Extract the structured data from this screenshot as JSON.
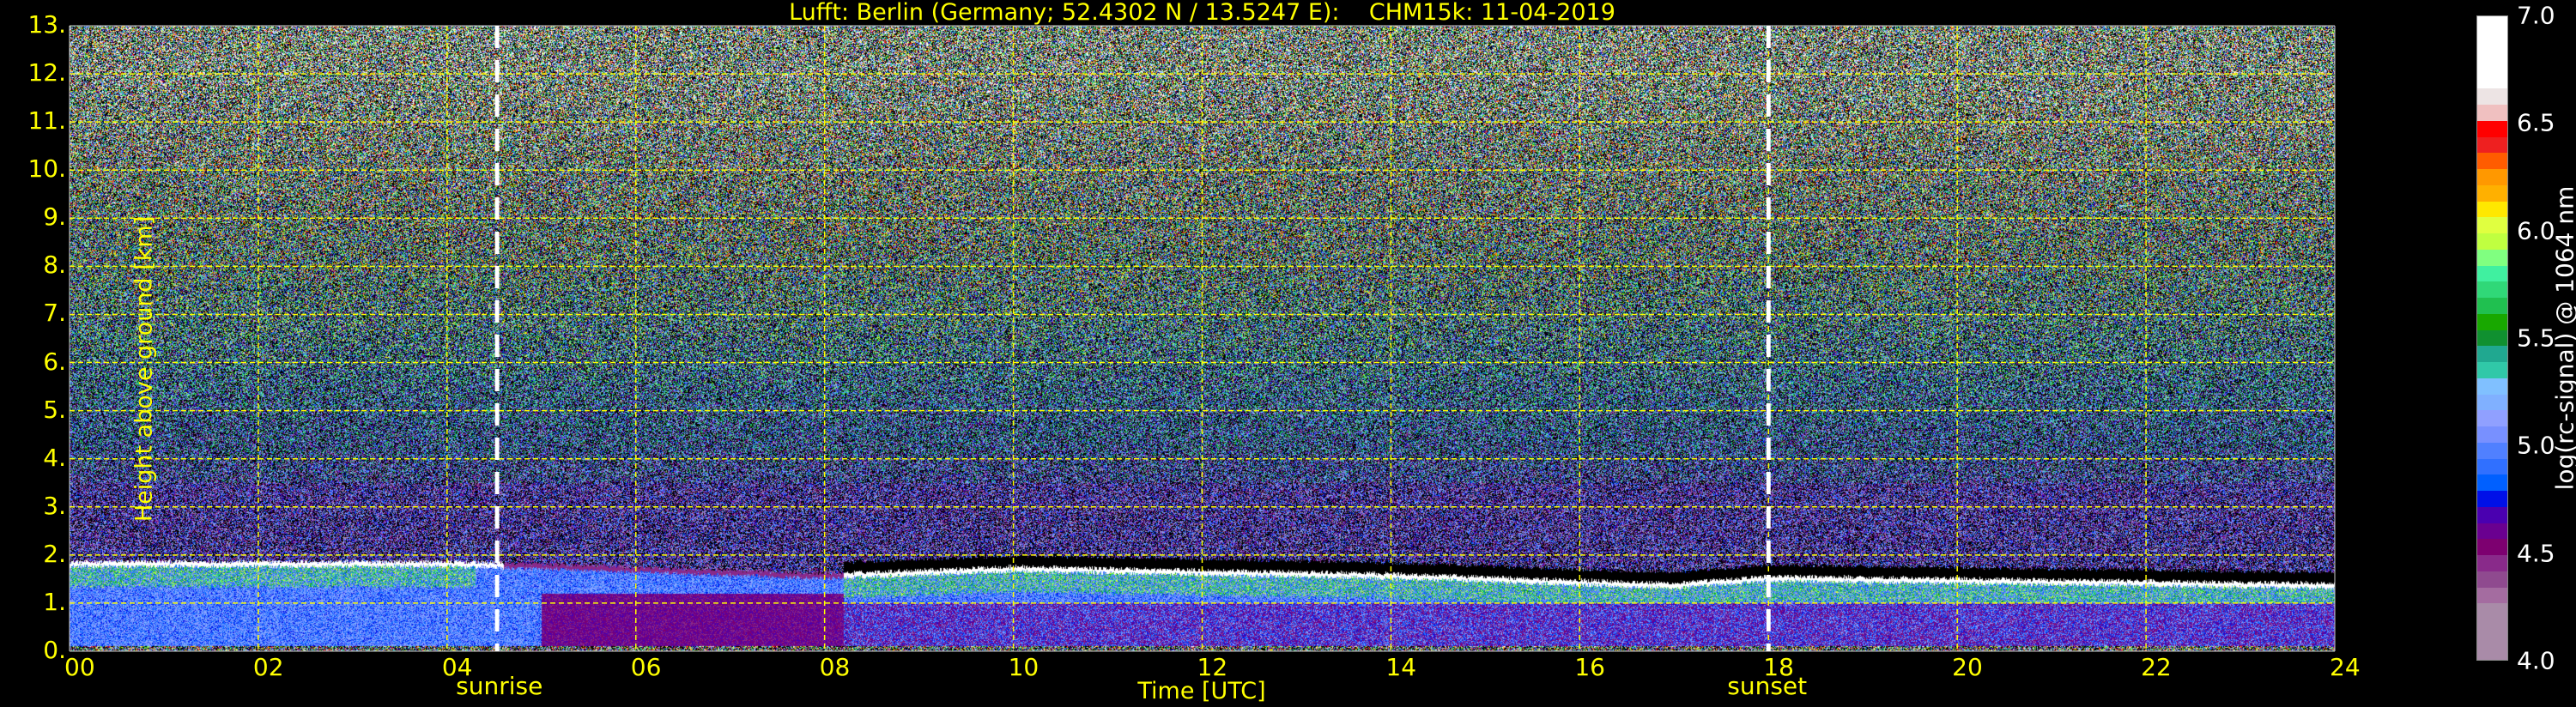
{
  "chart_data": {
    "type": "heatmap",
    "title": "Lufft: Berlin (Germany; 52.4302 N / 13.5247 E):    CHM15k: 11-04-2019",
    "xlabel": "Time [UTC]",
    "ylabel": "Height above ground [km]",
    "xlim": [
      0,
      24
    ],
    "ylim": [
      0,
      13
    ],
    "x_ticks": [
      "00",
      "02",
      "04",
      "06",
      "08",
      "10",
      "12",
      "14",
      "16",
      "18",
      "20",
      "22",
      "24"
    ],
    "y_ticks": [
      "0.",
      "1.",
      "2.",
      "3.",
      "4.",
      "5.",
      "6.",
      "7.",
      "8.",
      "9.",
      "10.",
      "11.",
      "12.",
      "13."
    ],
    "grid": true,
    "annotations": [
      {
        "label": "sunrise",
        "time_utc": 4.53
      },
      {
        "label": "sunset",
        "time_utc": 18.0
      }
    ],
    "boundary_layer_top_km": {
      "times": [
        0,
        4,
        5,
        8,
        10,
        14,
        17,
        18,
        24
      ],
      "heights": [
        1.85,
        1.85,
        1.8,
        1.6,
        1.75,
        1.6,
        1.4,
        1.55,
        1.4
      ]
    },
    "colorbar": {
      "label": "log(rc-signal) @ 1064 nm",
      "ticks": [
        "4.0",
        "4.5",
        "5.0",
        "5.5",
        "6.0",
        "6.5",
        "7.0"
      ],
      "range": [
        4.0,
        7.0
      ],
      "colors": [
        "#a98ba8",
        "#a46ca0",
        "#8f4a8f",
        "#892a8a",
        "#7d0070",
        "#6a0090",
        "#4a00b0",
        "#0010e8",
        "#0060ff",
        "#3070ff",
        "#5080ff",
        "#7890ff",
        "#90a0ff",
        "#80b0ff",
        "#80c0ff",
        "#30c8a8",
        "#20a890",
        "#109030",
        "#18a800",
        "#20c050",
        "#30d878",
        "#40f0a0",
        "#80ff80",
        "#c0ff40",
        "#e0ff40",
        "#ffe800",
        "#ffb000",
        "#ff9800",
        "#ff5c00",
        "#ee2020",
        "#ff0000",
        "#f0c0c0",
        "#ede4e4",
        "#ffffff"
      ]
    },
    "colors": {
      "text": "#ffff00",
      "grid": "#ffff00",
      "background": "#000000"
    }
  }
}
